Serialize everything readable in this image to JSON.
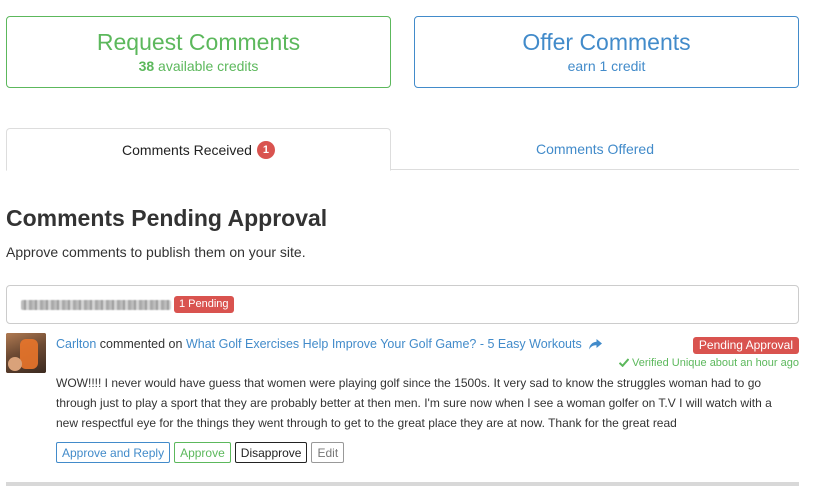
{
  "top_buttons": {
    "request": {
      "title": "Request Comments",
      "credits_count": "38",
      "credits_suffix": "available credits"
    },
    "offer": {
      "title": "Offer Comments",
      "subtitle": "earn 1 credit"
    }
  },
  "tabs": [
    {
      "label": "Comments Received",
      "badge": "1",
      "active": true
    },
    {
      "label": "Comments Offered",
      "active": false
    }
  ],
  "page": {
    "title": "Comments Pending Approval",
    "subtitle": "Approve comments to publish them on your site."
  },
  "site_bar": {
    "pending_badge": "1 Pending"
  },
  "comment": {
    "author": "Carlton",
    "verb": "commented on",
    "post_title": "What Golf Exercises Help Improve Your Golf Game? - 5 Easy Workouts",
    "status": "Pending Approval",
    "verified": "Verified Unique about an hour ago",
    "body": "WOW!!!! I never would have guess that women were playing golf since the 1500s. It very sad to know the struggles woman had to go through just to play a sport that they are probably better at then men. I'm sure now when I see a woman golfer on T.V I will watch with a new respectful eye for the things they went through to get to the great place they are at now. Thank for the great read",
    "actions": {
      "approve_reply": "Approve and Reply",
      "approve": "Approve",
      "disapprove": "Disapprove",
      "edit": "Edit"
    }
  },
  "icons": {
    "share": "share-arrow-icon",
    "check": "check-icon",
    "avatar": "user-avatar"
  },
  "colors": {
    "green": "#5cb85c",
    "blue": "#428bca",
    "red": "#d9534f"
  }
}
